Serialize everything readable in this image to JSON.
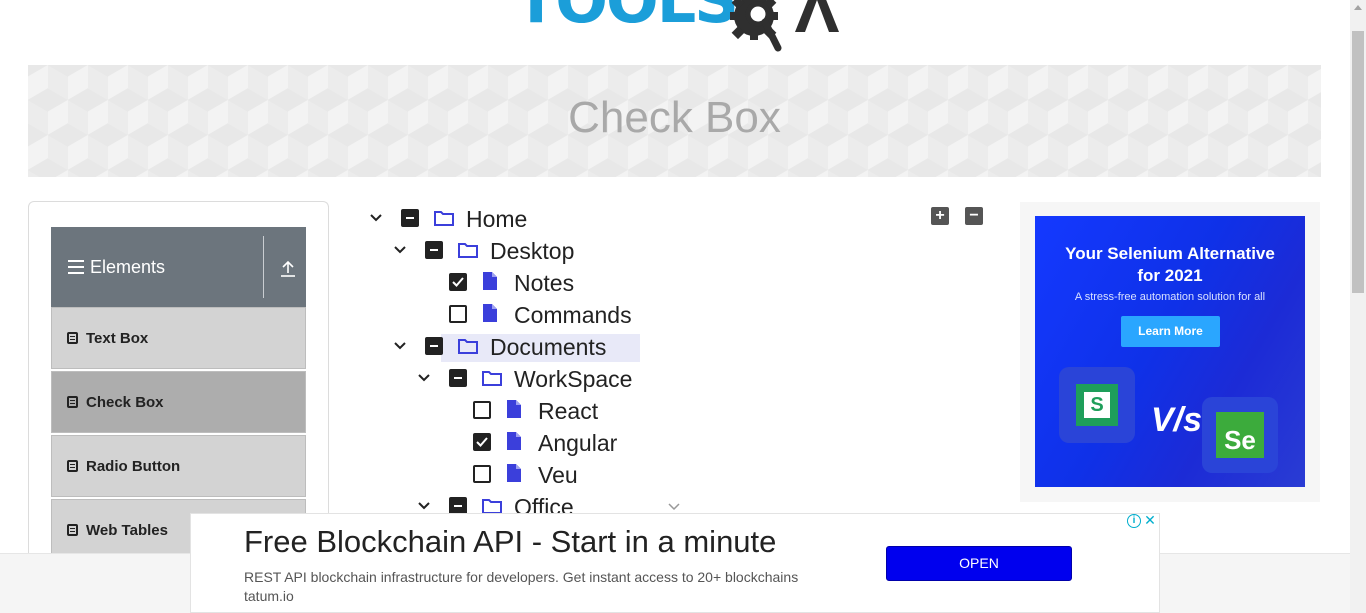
{
  "logo": {
    "left_text": "TOOLS",
    "right_text": "QA"
  },
  "page": {
    "title": "Check Box"
  },
  "sidebar": {
    "group_title": "Elements",
    "items": [
      {
        "label": "Text Box",
        "active": false
      },
      {
        "label": "Check Box",
        "active": true
      },
      {
        "label": "Radio Button",
        "active": false
      },
      {
        "label": "Web Tables",
        "active": false
      }
    ]
  },
  "tree": {
    "expand_all_label": "+",
    "collapse_all_label": "−",
    "nodes": [
      {
        "label": "Home",
        "type": "folder",
        "state": "partial",
        "expanded": true
      },
      {
        "label": "Desktop",
        "type": "folder",
        "state": "partial",
        "expanded": true
      },
      {
        "label": "Notes",
        "type": "file",
        "state": "checked"
      },
      {
        "label": "Commands",
        "type": "file",
        "state": "unchecked"
      },
      {
        "label": "Documents",
        "type": "folder",
        "state": "partial",
        "expanded": true,
        "highlighted": true
      },
      {
        "label": "WorkSpace",
        "type": "folder",
        "state": "partial",
        "expanded": true
      },
      {
        "label": "React",
        "type": "file",
        "state": "unchecked"
      },
      {
        "label": "Angular",
        "type": "file",
        "state": "checked"
      },
      {
        "label": "Veu",
        "type": "file",
        "state": "unchecked"
      },
      {
        "label": "Office",
        "type": "folder",
        "state": "partial",
        "expanded": true
      }
    ]
  },
  "side_ad": {
    "headline": "Your Selenium Alternative for 2021",
    "subline": "A stress-free automation solution for all",
    "button": "Learn More",
    "vs": "V/s",
    "left_logo": "S",
    "right_logo": "Se",
    "colors": {
      "bg": "#1439ff",
      "button": "#2aa6ff"
    }
  },
  "bottom_ad": {
    "title": "Free Blockchain API - Start in a minute",
    "description": "REST API blockchain infrastructure for developers. Get instant access to 20+ blockchains tatum.io",
    "button": "OPEN",
    "info": "i",
    "close": "✕"
  },
  "colors": {
    "brand_blue": "#1b9ed9",
    "sidebar_header": "#6c757d",
    "folder_icon": "#3b3fdb",
    "file_icon": "#3b3fdb"
  }
}
